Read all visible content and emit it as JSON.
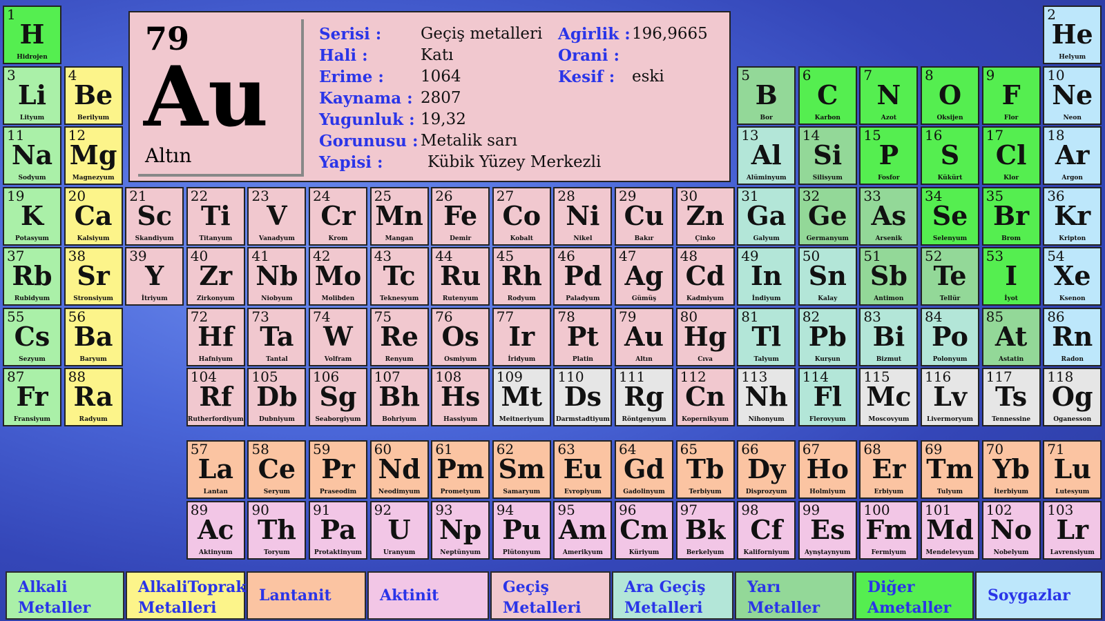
{
  "selected": {
    "number": "79",
    "symbol": "Au",
    "name": "Altın",
    "fields": [
      {
        "label": "Serisi :",
        "value": "Geçiş metalleri"
      },
      {
        "label": "Hali :",
        "value": "Katı"
      },
      {
        "label": "Erime :",
        "value": "1064"
      },
      {
        "label": "Kaynama :",
        "value": "2807"
      },
      {
        "label": "Yugunluk :",
        "value": "19,32"
      },
      {
        "label": "Gorunusu :",
        "value": "Metalik sarı"
      },
      {
        "label": "Yapisi :",
        "value": "Kübik Yüzey Merkezli"
      }
    ],
    "fields_right": [
      {
        "label": "Agirlik :",
        "value": "196,9665"
      },
      {
        "label": "Orani :",
        "value": ""
      },
      {
        "label": "Kesif :",
        "value": "eski"
      }
    ]
  },
  "elements": [
    {
      "n": "1",
      "s": "H",
      "name": "Hidrojen",
      "cat": "nonmetal",
      "c": 1,
      "r": 1
    },
    {
      "n": "2",
      "s": "He",
      "name": "Helyum",
      "cat": "noble",
      "c": 18,
      "r": 1
    },
    {
      "n": "3",
      "s": "Li",
      "name": "Lityum",
      "cat": "alkali",
      "c": 1,
      "r": 2
    },
    {
      "n": "4",
      "s": "Be",
      "name": "Berilyum",
      "cat": "alkaline",
      "c": 2,
      "r": 2
    },
    {
      "n": "5",
      "s": "B",
      "name": "Bor",
      "cat": "metalloid",
      "c": 13,
      "r": 2
    },
    {
      "n": "6",
      "s": "C",
      "name": "Karbon",
      "cat": "nonmetal",
      "c": 14,
      "r": 2
    },
    {
      "n": "7",
      "s": "N",
      "name": "Azot",
      "cat": "nonmetal",
      "c": 15,
      "r": 2
    },
    {
      "n": "8",
      "s": "O",
      "name": "Oksijen",
      "cat": "nonmetal",
      "c": 16,
      "r": 2
    },
    {
      "n": "9",
      "s": "F",
      "name": "Flor",
      "cat": "nonmetal",
      "c": 17,
      "r": 2
    },
    {
      "n": "10",
      "s": "Ne",
      "name": "Neon",
      "cat": "noble",
      "c": 18,
      "r": 2
    },
    {
      "n": "11",
      "s": "Na",
      "name": "Sodyum",
      "cat": "alkali",
      "c": 1,
      "r": 3
    },
    {
      "n": "12",
      "s": "Mg",
      "name": "Magnezyum",
      "cat": "alkaline",
      "c": 2,
      "r": 3
    },
    {
      "n": "13",
      "s": "Al",
      "name": "Alüminyum",
      "cat": "poor",
      "c": 13,
      "r": 3
    },
    {
      "n": "14",
      "s": "Si",
      "name": "Silisyum",
      "cat": "metalloid",
      "c": 14,
      "r": 3
    },
    {
      "n": "15",
      "s": "P",
      "name": "Fosfor",
      "cat": "nonmetal",
      "c": 15,
      "r": 3
    },
    {
      "n": "16",
      "s": "S",
      "name": "Kükürt",
      "cat": "nonmetal",
      "c": 16,
      "r": 3
    },
    {
      "n": "17",
      "s": "Cl",
      "name": "Klor",
      "cat": "nonmetal",
      "c": 17,
      "r": 3
    },
    {
      "n": "18",
      "s": "Ar",
      "name": "Argon",
      "cat": "noble",
      "c": 18,
      "r": 3
    },
    {
      "n": "19",
      "s": "K",
      "name": "Potasyum",
      "cat": "alkali",
      "c": 1,
      "r": 4
    },
    {
      "n": "20",
      "s": "Ca",
      "name": "Kalsiyum",
      "cat": "alkaline",
      "c": 2,
      "r": 4
    },
    {
      "n": "21",
      "s": "Sc",
      "name": "Skandiyum",
      "cat": "transition",
      "c": 3,
      "r": 4
    },
    {
      "n": "22",
      "s": "Ti",
      "name": "Titanyum",
      "cat": "transition",
      "c": 4,
      "r": 4
    },
    {
      "n": "23",
      "s": "V",
      "name": "Vanadyum",
      "cat": "transition",
      "c": 5,
      "r": 4
    },
    {
      "n": "24",
      "s": "Cr",
      "name": "Krom",
      "cat": "transition",
      "c": 6,
      "r": 4
    },
    {
      "n": "25",
      "s": "Mn",
      "name": "Mangan",
      "cat": "transition",
      "c": 7,
      "r": 4
    },
    {
      "n": "26",
      "s": "Fe",
      "name": "Demir",
      "cat": "transition",
      "c": 8,
      "r": 4
    },
    {
      "n": "27",
      "s": "Co",
      "name": "Kobalt",
      "cat": "transition",
      "c": 9,
      "r": 4
    },
    {
      "n": "28",
      "s": "Ni",
      "name": "Nikel",
      "cat": "transition",
      "c": 10,
      "r": 4
    },
    {
      "n": "29",
      "s": "Cu",
      "name": "Bakır",
      "cat": "transition",
      "c": 11,
      "r": 4
    },
    {
      "n": "30",
      "s": "Zn",
      "name": "Çinko",
      "cat": "transition",
      "c": 12,
      "r": 4
    },
    {
      "n": "31",
      "s": "Ga",
      "name": "Galyum",
      "cat": "poor",
      "c": 13,
      "r": 4
    },
    {
      "n": "32",
      "s": "Ge",
      "name": "Germanyum",
      "cat": "metalloid",
      "c": 14,
      "r": 4
    },
    {
      "n": "33",
      "s": "As",
      "name": "Arsenik",
      "cat": "metalloid",
      "c": 15,
      "r": 4
    },
    {
      "n": "34",
      "s": "Se",
      "name": "Selenyum",
      "cat": "nonmetal",
      "c": 16,
      "r": 4
    },
    {
      "n": "35",
      "s": "Br",
      "name": "Brom",
      "cat": "nonmetal",
      "c": 17,
      "r": 4
    },
    {
      "n": "36",
      "s": "Kr",
      "name": "Kripton",
      "cat": "noble",
      "c": 18,
      "r": 4
    },
    {
      "n": "37",
      "s": "Rb",
      "name": "Rubidyum",
      "cat": "alkali",
      "c": 1,
      "r": 5
    },
    {
      "n": "38",
      "s": "Sr",
      "name": "Stronsiyum",
      "cat": "alkaline",
      "c": 2,
      "r": 5
    },
    {
      "n": "39",
      "s": "Y",
      "name": "İtriyum",
      "cat": "transition",
      "c": 3,
      "r": 5
    },
    {
      "n": "40",
      "s": "Zr",
      "name": "Zirkonyum",
      "cat": "transition",
      "c": 4,
      "r": 5
    },
    {
      "n": "41",
      "s": "Nb",
      "name": "Niobyum",
      "cat": "transition",
      "c": 5,
      "r": 5
    },
    {
      "n": "42",
      "s": "Mo",
      "name": "Molibden",
      "cat": "transition",
      "c": 6,
      "r": 5
    },
    {
      "n": "43",
      "s": "Tc",
      "name": "Teknesyum",
      "cat": "transition",
      "c": 7,
      "r": 5
    },
    {
      "n": "44",
      "s": "Ru",
      "name": "Rutenyum",
      "cat": "transition",
      "c": 8,
      "r": 5
    },
    {
      "n": "45",
      "s": "Rh",
      "name": "Rodyum",
      "cat": "transition",
      "c": 9,
      "r": 5
    },
    {
      "n": "46",
      "s": "Pd",
      "name": "Paladyum",
      "cat": "transition",
      "c": 10,
      "r": 5
    },
    {
      "n": "47",
      "s": "Ag",
      "name": "Gümüş",
      "cat": "transition",
      "c": 11,
      "r": 5
    },
    {
      "n": "48",
      "s": "Cd",
      "name": "Kadmiyum",
      "cat": "transition",
      "c": 12,
      "r": 5
    },
    {
      "n": "49",
      "s": "In",
      "name": "İndiyum",
      "cat": "poor",
      "c": 13,
      "r": 5
    },
    {
      "n": "50",
      "s": "Sn",
      "name": "Kalay",
      "cat": "poor",
      "c": 14,
      "r": 5
    },
    {
      "n": "51",
      "s": "Sb",
      "name": "Antimon",
      "cat": "metalloid",
      "c": 15,
      "r": 5
    },
    {
      "n": "52",
      "s": "Te",
      "name": "Tellür",
      "cat": "metalloid",
      "c": 16,
      "r": 5
    },
    {
      "n": "53",
      "s": "I",
      "name": "İyot",
      "cat": "nonmetal",
      "c": 17,
      "r": 5
    },
    {
      "n": "54",
      "s": "Xe",
      "name": "Ksenon",
      "cat": "noble",
      "c": 18,
      "r": 5
    },
    {
      "n": "55",
      "s": "Cs",
      "name": "Sezyum",
      "cat": "alkali",
      "c": 1,
      "r": 6
    },
    {
      "n": "56",
      "s": "Ba",
      "name": "Baryum",
      "cat": "alkaline",
      "c": 2,
      "r": 6
    },
    {
      "n": "72",
      "s": "Hf",
      "name": "Hafniyum",
      "cat": "transition",
      "c": 4,
      "r": 6
    },
    {
      "n": "73",
      "s": "Ta",
      "name": "Tantal",
      "cat": "transition",
      "c": 5,
      "r": 6
    },
    {
      "n": "74",
      "s": "W",
      "name": "Volfram",
      "cat": "transition",
      "c": 6,
      "r": 6
    },
    {
      "n": "75",
      "s": "Re",
      "name": "Renyum",
      "cat": "transition",
      "c": 7,
      "r": 6
    },
    {
      "n": "76",
      "s": "Os",
      "name": "Osmiyum",
      "cat": "transition",
      "c": 8,
      "r": 6
    },
    {
      "n": "77",
      "s": "Ir",
      "name": "İridyum",
      "cat": "transition",
      "c": 9,
      "r": 6
    },
    {
      "n": "78",
      "s": "Pt",
      "name": "Platin",
      "cat": "transition",
      "c": 10,
      "r": 6
    },
    {
      "n": "79",
      "s": "Au",
      "name": "Altın",
      "cat": "transition",
      "c": 11,
      "r": 6
    },
    {
      "n": "80",
      "s": "Hg",
      "name": "Cıva",
      "cat": "transition",
      "c": 12,
      "r": 6
    },
    {
      "n": "81",
      "s": "Tl",
      "name": "Talyum",
      "cat": "poor",
      "c": 13,
      "r": 6
    },
    {
      "n": "82",
      "s": "Pb",
      "name": "Kurşun",
      "cat": "poor",
      "c": 14,
      "r": 6
    },
    {
      "n": "83",
      "s": "Bi",
      "name": "Bizmut",
      "cat": "poor",
      "c": 15,
      "r": 6
    },
    {
      "n": "84",
      "s": "Po",
      "name": "Polonyum",
      "cat": "poor",
      "c": 16,
      "r": 6
    },
    {
      "n": "85",
      "s": "At",
      "name": "Astatin",
      "cat": "metalloid",
      "c": 17,
      "r": 6
    },
    {
      "n": "86",
      "s": "Rn",
      "name": "Radon",
      "cat": "noble",
      "c": 18,
      "r": 6
    },
    {
      "n": "87",
      "s": "Fr",
      "name": "Fransiyum",
      "cat": "alkali",
      "c": 1,
      "r": 7
    },
    {
      "n": "88",
      "s": "Ra",
      "name": "Radyum",
      "cat": "alkaline",
      "c": 2,
      "r": 7
    },
    {
      "n": "104",
      "s": "Rf",
      "name": "Rutherfordiyum",
      "cat": "transition",
      "c": 4,
      "r": 7
    },
    {
      "n": "105",
      "s": "Db",
      "name": "Dubniyum",
      "cat": "transition",
      "c": 5,
      "r": 7
    },
    {
      "n": "106",
      "s": "Sg",
      "name": "Seaborgiyum",
      "cat": "transition",
      "c": 6,
      "r": 7
    },
    {
      "n": "107",
      "s": "Bh",
      "name": "Bohriyum",
      "cat": "transition",
      "c": 7,
      "r": 7
    },
    {
      "n": "108",
      "s": "Hs",
      "name": "Hassiyum",
      "cat": "transition",
      "c": 8,
      "r": 7
    },
    {
      "n": "109",
      "s": "Mt",
      "name": "Meitneriyum",
      "cat": "unknown",
      "c": 9,
      "r": 7
    },
    {
      "n": "110",
      "s": "Ds",
      "name": "Darmstadtiyum",
      "cat": "unknown",
      "c": 10,
      "r": 7
    },
    {
      "n": "111",
      "s": "Rg",
      "name": "Röntgenyum",
      "cat": "unknown",
      "c": 11,
      "r": 7
    },
    {
      "n": "112",
      "s": "Cn",
      "name": "Kopernikyum",
      "cat": "transition",
      "c": 12,
      "r": 7
    },
    {
      "n": "113",
      "s": "Nh",
      "name": "Nihonyum",
      "cat": "unknown",
      "c": 13,
      "r": 7
    },
    {
      "n": "114",
      "s": "Fl",
      "name": "Flerovyum",
      "cat": "poor",
      "c": 14,
      "r": 7
    },
    {
      "n": "115",
      "s": "Mc",
      "name": "Moscovyum",
      "cat": "unknown",
      "c": 15,
      "r": 7
    },
    {
      "n": "116",
      "s": "Lv",
      "name": "Livermoryum",
      "cat": "unknown",
      "c": 16,
      "r": 7
    },
    {
      "n": "117",
      "s": "Ts",
      "name": "Tennessine",
      "cat": "unknown",
      "c": 17,
      "r": 7
    },
    {
      "n": "118",
      "s": "Og",
      "name": "Oganesson",
      "cat": "unknown",
      "c": 18,
      "r": 7
    },
    {
      "n": "57",
      "s": "La",
      "name": "Lantan",
      "cat": "lanthanide",
      "c": 4,
      "r": 8
    },
    {
      "n": "58",
      "s": "Ce",
      "name": "Seryum",
      "cat": "lanthanide",
      "c": 5,
      "r": 8
    },
    {
      "n": "59",
      "s": "Pr",
      "name": "Praseodim",
      "cat": "lanthanide",
      "c": 6,
      "r": 8
    },
    {
      "n": "60",
      "s": "Nd",
      "name": "Neodimyum",
      "cat": "lanthanide",
      "c": 7,
      "r": 8
    },
    {
      "n": "61",
      "s": "Pm",
      "name": "Prometyum",
      "cat": "lanthanide",
      "c": 8,
      "r": 8
    },
    {
      "n": "62",
      "s": "Sm",
      "name": "Samaryum",
      "cat": "lanthanide",
      "c": 9,
      "r": 8
    },
    {
      "n": "63",
      "s": "Eu",
      "name": "Evropiyum",
      "cat": "lanthanide",
      "c": 10,
      "r": 8
    },
    {
      "n": "64",
      "s": "Gd",
      "name": "Gadolinyum",
      "cat": "lanthanide",
      "c": 11,
      "r": 8
    },
    {
      "n": "65",
      "s": "Tb",
      "name": "Terbiyum",
      "cat": "lanthanide",
      "c": 12,
      "r": 8
    },
    {
      "n": "66",
      "s": "Dy",
      "name": "Disprozyum",
      "cat": "lanthanide",
      "c": 13,
      "r": 8
    },
    {
      "n": "67",
      "s": "Ho",
      "name": "Holmiyum",
      "cat": "lanthanide",
      "c": 14,
      "r": 8
    },
    {
      "n": "68",
      "s": "Er",
      "name": "Erbiyum",
      "cat": "lanthanide",
      "c": 15,
      "r": 8
    },
    {
      "n": "69",
      "s": "Tm",
      "name": "Tulyum",
      "cat": "lanthanide",
      "c": 16,
      "r": 8
    },
    {
      "n": "70",
      "s": "Yb",
      "name": "İterbiyum",
      "cat": "lanthanide",
      "c": 17,
      "r": 8
    },
    {
      "n": "71",
      "s": "Lu",
      "name": "Lutesyum",
      "cat": "lanthanide",
      "c": 18,
      "r": 8
    },
    {
      "n": "89",
      "s": "Ac",
      "name": "Aktinyum",
      "cat": "actinide",
      "c": 4,
      "r": 9
    },
    {
      "n": "90",
      "s": "Th",
      "name": "Toryum",
      "cat": "actinide",
      "c": 5,
      "r": 9
    },
    {
      "n": "91",
      "s": "Pa",
      "name": "Protaktinyum",
      "cat": "actinide",
      "c": 6,
      "r": 9
    },
    {
      "n": "92",
      "s": "U",
      "name": "Uranyum",
      "cat": "actinide",
      "c": 7,
      "r": 9
    },
    {
      "n": "93",
      "s": "Np",
      "name": "Neptünyum",
      "cat": "actinide",
      "c": 8,
      "r": 9
    },
    {
      "n": "94",
      "s": "Pu",
      "name": "Plütonyum",
      "cat": "actinide",
      "c": 9,
      "r": 9
    },
    {
      "n": "95",
      "s": "Am",
      "name": "Amerikyum",
      "cat": "actinide",
      "c": 10,
      "r": 9
    },
    {
      "n": "96",
      "s": "Cm",
      "name": "Küriyum",
      "cat": "actinide",
      "c": 11,
      "r": 9
    },
    {
      "n": "97",
      "s": "Bk",
      "name": "Berkelyum",
      "cat": "actinide",
      "c": 12,
      "r": 9
    },
    {
      "n": "98",
      "s": "Cf",
      "name": "Kaliforniyum",
      "cat": "actinide",
      "c": 13,
      "r": 9
    },
    {
      "n": "99",
      "s": "Es",
      "name": "Aynştaynyum",
      "cat": "actinide",
      "c": 14,
      "r": 9
    },
    {
      "n": "100",
      "s": "Fm",
      "name": "Fermiyum",
      "cat": "actinide",
      "c": 15,
      "r": 9
    },
    {
      "n": "101",
      "s": "Md",
      "name": "Mendelevyum",
      "cat": "actinide",
      "c": 16,
      "r": 9
    },
    {
      "n": "102",
      "s": "No",
      "name": "Nobelyum",
      "cat": "actinide",
      "c": 17,
      "r": 9
    },
    {
      "n": "103",
      "s": "Lr",
      "name": "Lavrensiyum",
      "cat": "actinide",
      "c": 18,
      "r": 9
    }
  ],
  "legend": [
    {
      "cat": "alkali",
      "line1": "Alkali",
      "line2": "Metaller"
    },
    {
      "cat": "alkaline",
      "line1": "AlkaliToprak",
      "line2": "Metalleri"
    },
    {
      "cat": "lanthanide",
      "line1": "Lantanit",
      "line2": ""
    },
    {
      "cat": "actinide",
      "line1": "Aktinit",
      "line2": ""
    },
    {
      "cat": "transition",
      "line1": "Geçiş",
      "line2": "Metalleri"
    },
    {
      "cat": "poor",
      "line1": "Ara Geçiş",
      "line2": "Metalleri"
    },
    {
      "cat": "metalloid",
      "line1": "Yarı",
      "line2": "Metaller"
    },
    {
      "cat": "nonmetal",
      "line1": "Diğer",
      "line2": "Ametaller"
    },
    {
      "cat": "noble",
      "line1": "Soygazlar",
      "line2": ""
    }
  ],
  "colors": {
    "label_blue": "#2a35e8",
    "alkali": "#aaf0a8",
    "alkaline": "#fcf48a",
    "lanthanide": "#fbc4a2",
    "actinide": "#f2c6e6",
    "transition": "#f1c8cf",
    "unknown": "#e6e6e6",
    "poor": "#b3e6d8",
    "metalloid": "#93d898",
    "nonmetal": "#55ee50",
    "noble": "#bde7fb"
  }
}
